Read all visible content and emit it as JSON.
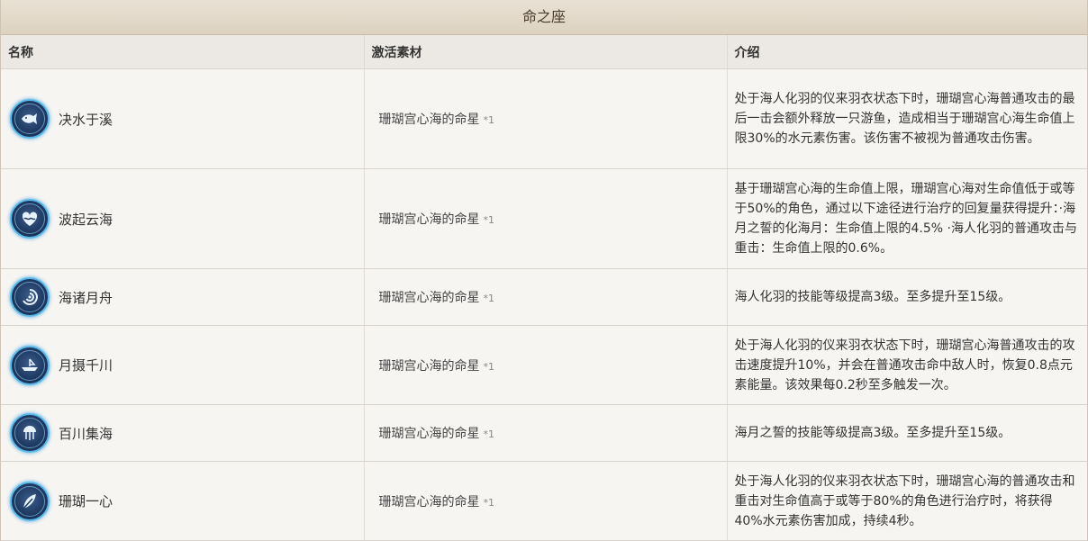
{
  "title": "命之座",
  "headers": {
    "name": "名称",
    "material": "激活素材",
    "desc": "介绍"
  },
  "rows": [
    {
      "name": "决水于溪",
      "icon": "fish-icon",
      "material": "珊瑚宫心海的命星",
      "count": "*1",
      "desc": "处于海人化羽的仪来羽衣状态下时，珊瑚宫心海普通攻击的最后一击会额外释放一只游鱼，造成相当于珊瑚宫心海生命值上限30%的水元素伤害。该伤害不被视为普通攻击伤害。"
    },
    {
      "name": "波起云海",
      "icon": "heart-wave-icon",
      "material": "珊瑚宫心海的命星",
      "count": "*1",
      "desc": "基于珊瑚宫心海的生命值上限，珊瑚宫心海对生命值低于或等于50%的角色，通过以下途径进行治疗的回复量获得提升：·海月之誓的化海月：生命值上限的4.5% ·海人化羽的普通攻击与重击：生命值上限的0.6%。"
    },
    {
      "name": "海诸月舟",
      "icon": "spiral-icon",
      "material": "珊瑚宫心海的命星",
      "count": "*1",
      "desc": "海人化羽的技能等级提高3级。至多提升至15级。"
    },
    {
      "name": "月摄千川",
      "icon": "boat-icon",
      "material": "珊瑚宫心海的命星",
      "count": "*1",
      "desc": "处于海人化羽的仪来羽衣状态下时，珊瑚宫心海普通攻击的攻击速度提升10%，并会在普通攻击命中敌人时，恢复0.8点元素能量。该效果每0.2秒至多触发一次。"
    },
    {
      "name": "百川集海",
      "icon": "jellyfish-icon",
      "material": "珊瑚宫心海的命星",
      "count": "*1",
      "desc": "海月之誓的技能等级提高3级。至多提升至15级。"
    },
    {
      "name": "珊瑚一心",
      "icon": "feather-icon",
      "material": "珊瑚宫心海的命星",
      "count": "*1",
      "desc": "处于海人化羽的仪来羽衣状态下时，珊瑚宫心海的普通攻击和重击对生命值高于或等于80%的角色进行治疗时，将获得40%水元素伤害加成，持续4秒。"
    }
  ]
}
